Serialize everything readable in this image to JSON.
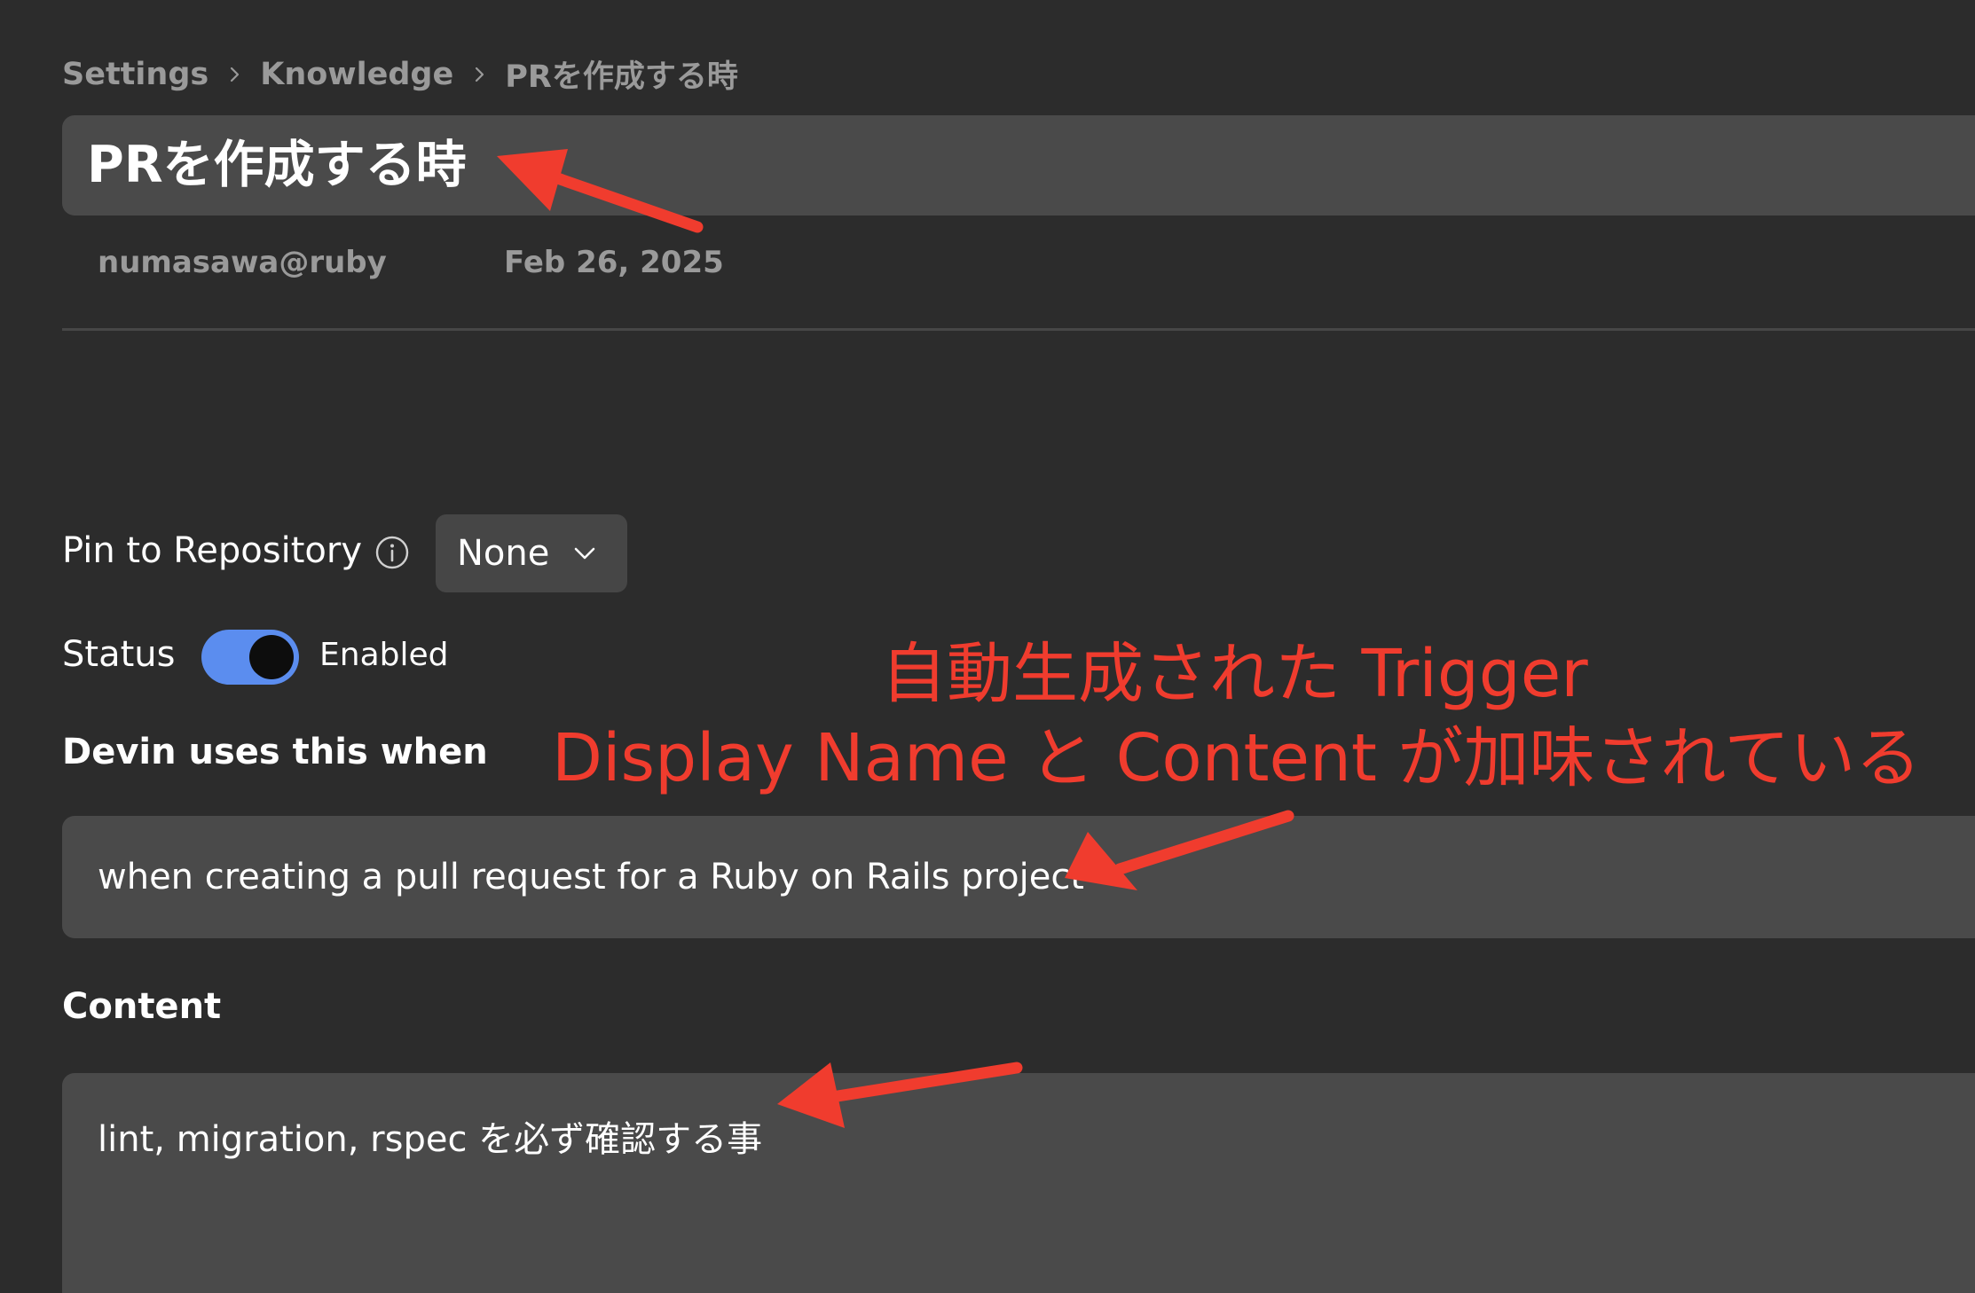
{
  "breadcrumb": {
    "items": [
      "Settings",
      "Knowledge",
      "PRを作成する時"
    ]
  },
  "knowledge": {
    "title": "PRを作成する時",
    "author": "numasawa@ruby",
    "date": "Feb 26, 2025"
  },
  "pin": {
    "label": "Pin to Repository",
    "value": "None"
  },
  "status": {
    "label": "Status",
    "state_label": "Enabled",
    "enabled": true
  },
  "trigger": {
    "label": "Devin uses this when",
    "value": "when creating a pull request for a Ruby on Rails project"
  },
  "content": {
    "label": "Content",
    "value": "lint, migration, rspec を必ず確認する事"
  },
  "annotations": {
    "line1": "自動生成された Trigger",
    "line2": "Display Name と Content が加味されている",
    "color": "#f03c2e"
  },
  "icons": {
    "breadcrumb_separator": "chevron-right-icon",
    "info": "info-icon",
    "dropdown": "chevron-down-icon"
  },
  "colors": {
    "background": "#2c2c2c",
    "field": "#4a4a4a",
    "toggle_on": "#5b8def",
    "muted_text": "#9a9a9a"
  }
}
